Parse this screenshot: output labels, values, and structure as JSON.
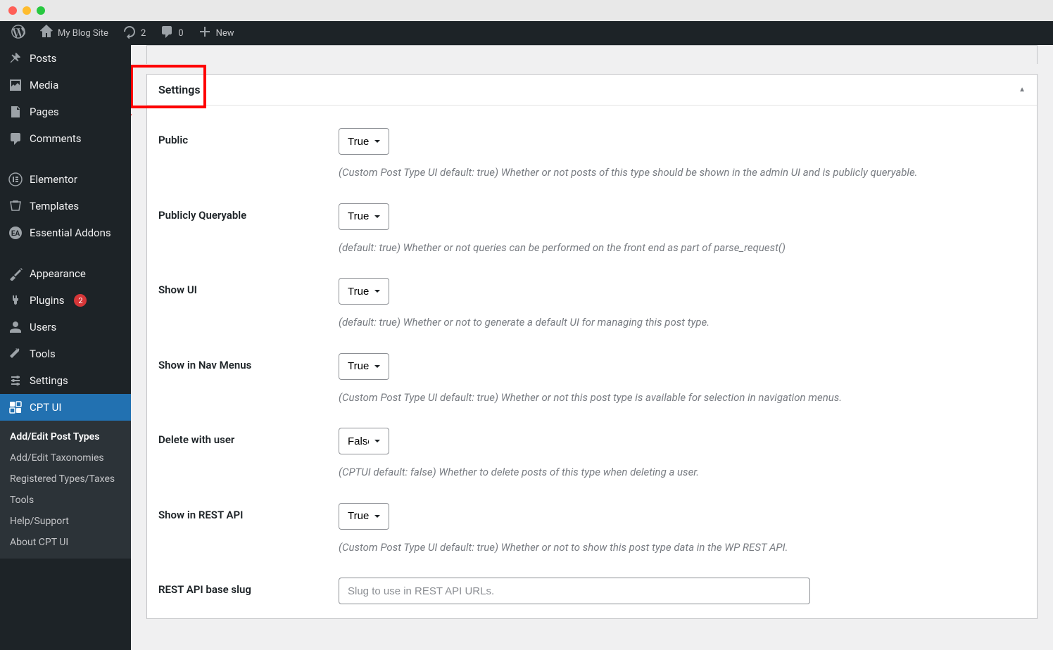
{
  "adminbar": {
    "site_title": "My Blog Site",
    "updates_count": "2",
    "comments_count": "0",
    "new_label": "New"
  },
  "adminmenu": {
    "items": [
      {
        "icon": "pin",
        "label": "Posts"
      },
      {
        "icon": "media",
        "label": "Media"
      },
      {
        "icon": "page",
        "label": "Pages"
      },
      {
        "icon": "comments",
        "label": "Comments"
      }
    ],
    "items2": [
      {
        "icon": "elementor",
        "label": "Elementor"
      },
      {
        "icon": "templates",
        "label": "Templates"
      },
      {
        "icon": "ea",
        "label": "Essential Addons"
      }
    ],
    "items3": [
      {
        "icon": "appearance",
        "label": "Appearance"
      },
      {
        "icon": "plugins",
        "label": "Plugins",
        "badge": "2"
      },
      {
        "icon": "users",
        "label": "Users"
      },
      {
        "icon": "tools",
        "label": "Tools"
      },
      {
        "icon": "settings",
        "label": "Settings"
      }
    ],
    "current": {
      "icon": "cptui",
      "label": "CPT UI"
    },
    "submenu": [
      {
        "label": "Add/Edit Post Types",
        "current": true
      },
      {
        "label": "Add/Edit Taxonomies"
      },
      {
        "label": "Registered Types/Taxes"
      },
      {
        "label": "Tools"
      },
      {
        "label": "Help/Support"
      },
      {
        "label": "About CPT UI"
      }
    ]
  },
  "postbox": {
    "title": "Settings",
    "rows": [
      {
        "label": "Public",
        "value": "True",
        "desc": "(Custom Post Type UI default: true) Whether or not posts of this type should be shown in the admin UI and is publicly queryable."
      },
      {
        "label": "Publicly Queryable",
        "value": "True",
        "desc": "(default: true) Whether or not queries can be performed on the front end as part of parse_request()"
      },
      {
        "label": "Show UI",
        "value": "True",
        "desc": "(default: true) Whether or not to generate a default UI for managing this post type."
      },
      {
        "label": "Show in Nav Menus",
        "value": "True",
        "desc": "(Custom Post Type UI default: true) Whether or not this post type is available for selection in navigation menus."
      },
      {
        "label": "Delete with user",
        "value": "False",
        "desc": "(CPTUI default: false) Whether to delete posts of this type when deleting a user."
      },
      {
        "label": "Show in REST API",
        "value": "True",
        "desc": "(Custom Post Type UI default: true) Whether or not to show this post type data in the WP REST API."
      }
    ],
    "text_row": {
      "label": "REST API base slug",
      "placeholder": "Slug to use in REST API URLs."
    }
  },
  "select_options": {
    "true": "True",
    "false": "False"
  }
}
